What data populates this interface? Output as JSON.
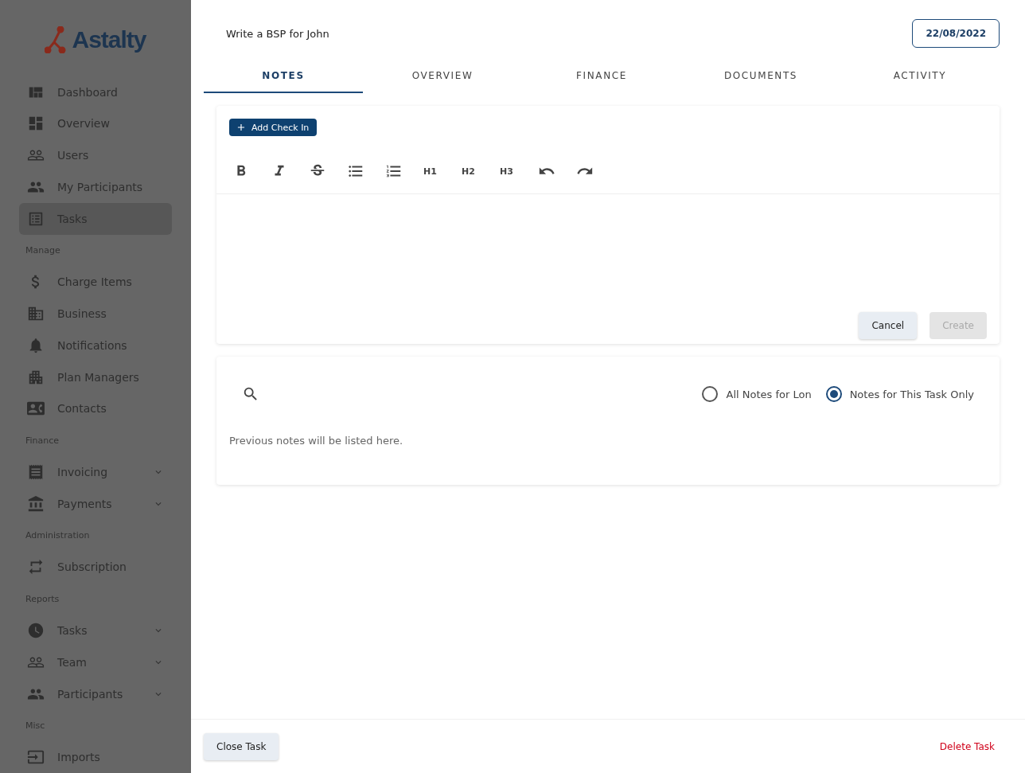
{
  "sidebar": {
    "logo": "Astalty",
    "items": [
      {
        "kind": "item",
        "label": "Dashboard",
        "selected": false,
        "expandable": false
      },
      {
        "kind": "item",
        "label": "Overview",
        "selected": false,
        "expandable": false
      },
      {
        "kind": "item",
        "label": "Users",
        "selected": false,
        "expandable": false
      },
      {
        "kind": "item",
        "label": "My Participants",
        "selected": false,
        "expandable": false
      },
      {
        "kind": "item",
        "label": "Tasks",
        "selected": true,
        "expandable": false
      },
      {
        "kind": "section",
        "label": "Manage"
      },
      {
        "kind": "item",
        "label": "Charge Items",
        "selected": false,
        "expandable": false
      },
      {
        "kind": "item",
        "label": "Business",
        "selected": false,
        "expandable": false
      },
      {
        "kind": "item",
        "label": "Notifications",
        "selected": false,
        "expandable": false
      },
      {
        "kind": "item",
        "label": "Plan Managers",
        "selected": false,
        "expandable": false
      },
      {
        "kind": "item",
        "label": "Contacts",
        "selected": false,
        "expandable": false
      },
      {
        "kind": "section",
        "label": "Finance"
      },
      {
        "kind": "item",
        "label": "Invoicing",
        "selected": false,
        "expandable": true
      },
      {
        "kind": "item",
        "label": "Payments",
        "selected": false,
        "expandable": true
      },
      {
        "kind": "section",
        "label": "Administration"
      },
      {
        "kind": "item",
        "label": "Subscription",
        "selected": false,
        "expandable": false
      },
      {
        "kind": "section",
        "label": "Reports"
      },
      {
        "kind": "item",
        "label": "Tasks",
        "selected": false,
        "expandable": true
      },
      {
        "kind": "item",
        "label": "Team",
        "selected": false,
        "expandable": true
      },
      {
        "kind": "item",
        "label": "Participants",
        "selected": false,
        "expandable": true
      },
      {
        "kind": "section",
        "label": "Misc"
      },
      {
        "kind": "item",
        "label": "Imports",
        "selected": false,
        "expandable": false
      }
    ]
  },
  "task": {
    "title": "Write a BSP for John",
    "date": "22/08/2022"
  },
  "tabs": [
    {
      "label": "NOTES",
      "selected": true
    },
    {
      "label": "OVERVIEW",
      "selected": false
    },
    {
      "label": "FINANCE",
      "selected": false
    },
    {
      "label": "DOCUMENTS",
      "selected": false
    },
    {
      "label": "ACTIVITY",
      "selected": false
    }
  ],
  "editor": {
    "add_button": "Add Check In",
    "toolbar": [
      "H1",
      "H2",
      "H3"
    ],
    "cancel": "Cancel",
    "create": {
      "label": "Create",
      "disabled": true
    }
  },
  "notes": {
    "filters": [
      {
        "label": "All Notes for Lon",
        "selected": false
      },
      {
        "label": "Notes for This Task Only",
        "selected": true
      }
    ],
    "empty": "Previous notes will be listed here."
  },
  "footer": {
    "close": "Close Task",
    "delete": "Delete Task"
  }
}
